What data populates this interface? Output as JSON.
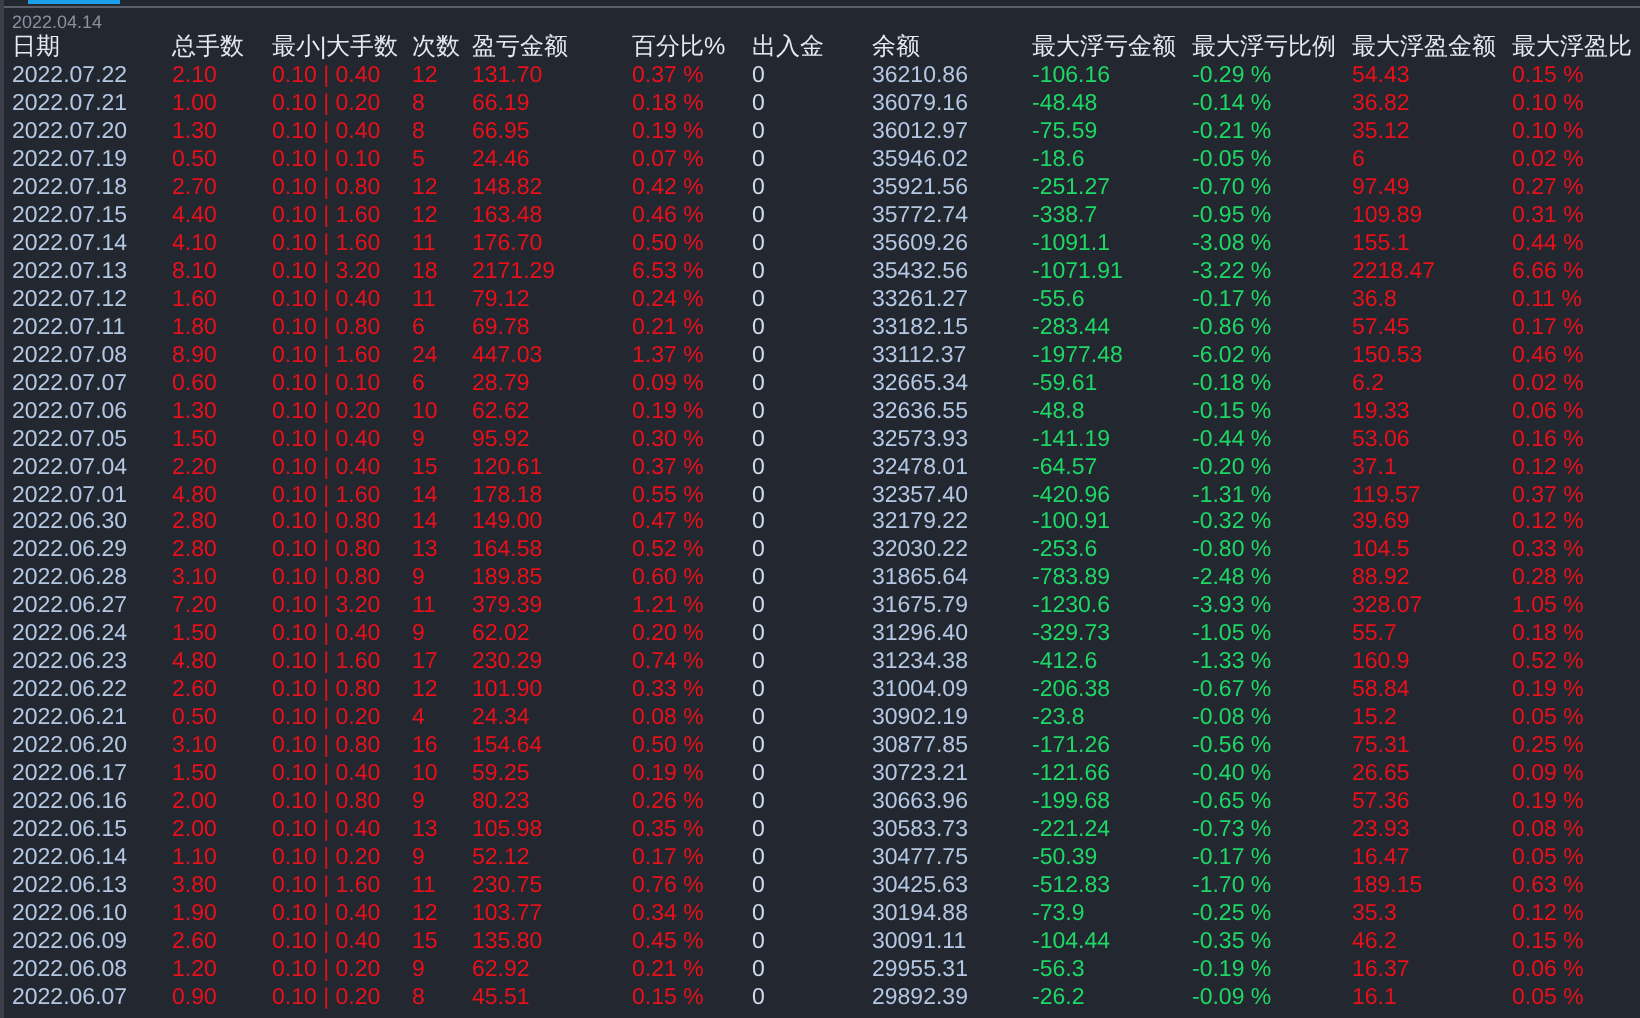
{
  "toolbar": {
    "date": "2022.04.14"
  },
  "table": {
    "columns": [
      {
        "label": "日期",
        "color": "#b4c8e4"
      },
      {
        "label": "总手数",
        "color": "#e8101a"
      },
      {
        "label": "最小|大手数",
        "color": "#e8101a"
      },
      {
        "label": "次数",
        "color": "#e8101a"
      },
      {
        "label": "盈亏金额",
        "color": "#e8101a"
      },
      {
        "label": "百分比%",
        "color": "#e8101a"
      },
      {
        "label": "出入金",
        "color": "#d0dcee"
      },
      {
        "label": "余额",
        "color": "#b4c8e4"
      },
      {
        "label": "最大浮亏金额",
        "color": "#1ed865"
      },
      {
        "label": "最大浮亏比例",
        "color": "#1ed865"
      },
      {
        "label": "最大浮盈金额",
        "color": "#e8101a"
      },
      {
        "label": "最大浮盈比",
        "color": "#e8101a"
      }
    ],
    "rows": [
      {
        "cells": [
          "2022.07.22",
          "2.10",
          "0.10 | 0.40",
          "12",
          "131.70",
          "0.37 %",
          "0",
          "36210.86",
          "-106.16",
          "-0.29 %",
          "54.43",
          "0.15 %"
        ]
      },
      {
        "cells": [
          "2022.07.21",
          "1.00",
          "0.10 | 0.20",
          "8",
          "66.19",
          "0.18 %",
          "0",
          "36079.16",
          "-48.48",
          "-0.14 %",
          "36.82",
          "0.10 %"
        ]
      },
      {
        "cells": [
          "2022.07.20",
          "1.30",
          "0.10 | 0.40",
          "8",
          "66.95",
          "0.19 %",
          "0",
          "36012.97",
          "-75.59",
          "-0.21 %",
          "35.12",
          "0.10 %"
        ]
      },
      {
        "cells": [
          "2022.07.19",
          "0.50",
          "0.10 | 0.10",
          "5",
          "24.46",
          "0.07 %",
          "0",
          "35946.02",
          "-18.6",
          "-0.05 %",
          "6",
          "0.02 %"
        ]
      },
      {
        "cells": [
          "2022.07.18",
          "2.70",
          "0.10 | 0.80",
          "12",
          "148.82",
          "0.42 %",
          "0",
          "35921.56",
          "-251.27",
          "-0.70 %",
          "97.49",
          "0.27 %"
        ]
      },
      {
        "cells": [
          "2022.07.15",
          "4.40",
          "0.10 | 1.60",
          "12",
          "163.48",
          "0.46 %",
          "0",
          "35772.74",
          "-338.7",
          "-0.95 %",
          "109.89",
          "0.31 %"
        ]
      },
      {
        "cells": [
          "2022.07.14",
          "4.10",
          "0.10 | 1.60",
          "11",
          "176.70",
          "0.50 %",
          "0",
          "35609.26",
          "-1091.1",
          "-3.08 %",
          "155.1",
          "0.44 %"
        ]
      },
      {
        "cells": [
          "2022.07.13",
          "8.10",
          "0.10 | 3.20",
          "18",
          "2171.29",
          "6.53 %",
          "0",
          "35432.56",
          "-1071.91",
          "-3.22 %",
          "2218.47",
          "6.66 %"
        ]
      },
      {
        "cells": [
          "2022.07.12",
          "1.60",
          "0.10 | 0.40",
          "11",
          "79.12",
          "0.24 %",
          "0",
          "33261.27",
          "-55.6",
          "-0.17 %",
          "36.8",
          "0.11 %"
        ]
      },
      {
        "cells": [
          "2022.07.11",
          "1.80",
          "0.10 | 0.80",
          "6",
          "69.78",
          "0.21 %",
          "0",
          "33182.15",
          "-283.44",
          "-0.86 %",
          "57.45",
          "0.17 %"
        ]
      },
      {
        "cells": [
          "2022.07.08",
          "8.90",
          "0.10 | 1.60",
          "24",
          "447.03",
          "1.37 %",
          "0",
          "33112.37",
          "-1977.48",
          "-6.02 %",
          "150.53",
          "0.46 %"
        ]
      },
      {
        "cells": [
          "2022.07.07",
          "0.60",
          "0.10 | 0.10",
          "6",
          "28.79",
          "0.09 %",
          "0",
          "32665.34",
          "-59.61",
          "-0.18 %",
          "6.2",
          "0.02 %"
        ]
      },
      {
        "cells": [
          "2022.07.06",
          "1.30",
          "0.10 | 0.20",
          "10",
          "62.62",
          "0.19 %",
          "0",
          "32636.55",
          "-48.8",
          "-0.15 %",
          "19.33",
          "0.06 %"
        ]
      },
      {
        "cells": [
          "2022.07.05",
          "1.50",
          "0.10 | 0.40",
          "9",
          "95.92",
          "0.30 %",
          "0",
          "32573.93",
          "-141.19",
          "-0.44 %",
          "53.06",
          "0.16 %"
        ]
      },
      {
        "cells": [
          "2022.07.04",
          "2.20",
          "0.10 | 0.40",
          "15",
          "120.61",
          "0.37 %",
          "0",
          "32478.01",
          "-64.57",
          "-0.20 %",
          "37.1",
          "0.12 %"
        ]
      },
      {
        "cells": [
          "2022.07.01",
          "4.80",
          "0.10 | 1.60",
          "14",
          "178.18",
          "0.55 %",
          "0",
          "32357.40",
          "-420.96",
          "-1.31 %",
          "119.57",
          "0.37 %"
        ]
      },
      {
        "cells": [
          "2022.06.30",
          "2.80",
          "0.10 | 0.80",
          "14",
          "149.00",
          "0.47 %",
          "0",
          "32179.22",
          "-100.91",
          "-0.32 %",
          "39.69",
          "0.12 %"
        ]
      },
      {
        "cells": [
          "2022.06.29",
          "2.80",
          "0.10 | 0.80",
          "13",
          "164.58",
          "0.52 %",
          "0",
          "32030.22",
          "-253.6",
          "-0.80 %",
          "104.5",
          "0.33 %"
        ]
      },
      {
        "cells": [
          "2022.06.28",
          "3.10",
          "0.10 | 0.80",
          "9",
          "189.85",
          "0.60 %",
          "0",
          "31865.64",
          "-783.89",
          "-2.48 %",
          "88.92",
          "0.28 %"
        ]
      },
      {
        "cells": [
          "2022.06.27",
          "7.20",
          "0.10 | 3.20",
          "11",
          "379.39",
          "1.21 %",
          "0",
          "31675.79",
          "-1230.6",
          "-3.93 %",
          "328.07",
          "1.05 %"
        ]
      },
      {
        "cells": [
          "2022.06.24",
          "1.50",
          "0.10 | 0.40",
          "9",
          "62.02",
          "0.20 %",
          "0",
          "31296.40",
          "-329.73",
          "-1.05 %",
          "55.7",
          "0.18 %"
        ]
      },
      {
        "cells": [
          "2022.06.23",
          "4.80",
          "0.10 | 1.60",
          "17",
          "230.29",
          "0.74 %",
          "0",
          "31234.38",
          "-412.6",
          "-1.33 %",
          "160.9",
          "0.52 %"
        ]
      },
      {
        "cells": [
          "2022.06.22",
          "2.60",
          "0.10 | 0.80",
          "12",
          "101.90",
          "0.33 %",
          "0",
          "31004.09",
          "-206.38",
          "-0.67 %",
          "58.84",
          "0.19 %"
        ]
      },
      {
        "cells": [
          "2022.06.21",
          "0.50",
          "0.10 | 0.20",
          "4",
          "24.34",
          "0.08 %",
          "0",
          "30902.19",
          "-23.8",
          "-0.08 %",
          "15.2",
          "0.05 %"
        ]
      },
      {
        "cells": [
          "2022.06.20",
          "3.10",
          "0.10 | 0.80",
          "16",
          "154.64",
          "0.50 %",
          "0",
          "30877.85",
          "-171.26",
          "-0.56 %",
          "75.31",
          "0.25 %"
        ]
      },
      {
        "cells": [
          "2022.06.17",
          "1.50",
          "0.10 | 0.40",
          "10",
          "59.25",
          "0.19 %",
          "0",
          "30723.21",
          "-121.66",
          "-0.40 %",
          "26.65",
          "0.09 %"
        ]
      },
      {
        "cells": [
          "2022.06.16",
          "2.00",
          "0.10 | 0.80",
          "9",
          "80.23",
          "0.26 %",
          "0",
          "30663.96",
          "-199.68",
          "-0.65 %",
          "57.36",
          "0.19 %"
        ]
      },
      {
        "cells": [
          "2022.06.15",
          "2.00",
          "0.10 | 0.40",
          "13",
          "105.98",
          "0.35 %",
          "0",
          "30583.73",
          "-221.24",
          "-0.73 %",
          "23.93",
          "0.08 %"
        ]
      },
      {
        "cells": [
          "2022.06.14",
          "1.10",
          "0.10 | 0.20",
          "9",
          "52.12",
          "0.17 %",
          "0",
          "30477.75",
          "-50.39",
          "-0.17 %",
          "16.47",
          "0.05 %"
        ]
      },
      {
        "cells": [
          "2022.06.13",
          "3.80",
          "0.10 | 1.60",
          "11",
          "230.75",
          "0.76 %",
          "0",
          "30425.63",
          "-512.83",
          "-1.70 %",
          "189.15",
          "0.63 %"
        ]
      },
      {
        "cells": [
          "2022.06.10",
          "1.90",
          "0.10 | 0.40",
          "12",
          "103.77",
          "0.34 %",
          "0",
          "30194.88",
          "-73.9",
          "-0.25 %",
          "35.3",
          "0.12 %"
        ]
      },
      {
        "cells": [
          "2022.06.09",
          "2.60",
          "0.10 | 0.40",
          "15",
          "135.80",
          "0.45 %",
          "0",
          "30091.11",
          "-104.44",
          "-0.35 %",
          "46.2",
          "0.15 %"
        ]
      },
      {
        "cells": [
          "2022.06.08",
          "1.20",
          "0.10 | 0.20",
          "9",
          "62.92",
          "0.21 %",
          "0",
          "29955.31",
          "-56.3",
          "-0.19 %",
          "16.37",
          "0.06 %"
        ]
      },
      {
        "cells": [
          "2022.06.07",
          "0.90",
          "0.10 | 0.20",
          "8",
          "45.51",
          "0.15 %",
          "0",
          "29892.39",
          "-26.2",
          "-0.09 %",
          "16.1",
          "0.05 %"
        ]
      }
    ]
  }
}
